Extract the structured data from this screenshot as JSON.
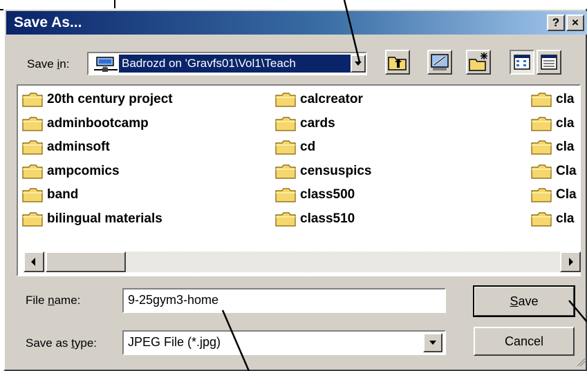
{
  "dialog": {
    "title": "Save As...",
    "help_label": "?",
    "close_label": "×"
  },
  "save_in": {
    "label_before": "Save ",
    "label_accel": "i",
    "label_after": "n:",
    "value": "Badrozd on 'Gravfs01\\Vol1\\Teach"
  },
  "toolbar": {
    "icons": [
      "up-one-level-icon",
      "desktop-icon",
      "new-folder-icon",
      "list-view-icon",
      "details-view-icon"
    ]
  },
  "files": {
    "col1": [
      "20th century project",
      "adminbootcamp",
      "adminsoft",
      "ampcomics",
      "band",
      "bilingual materials"
    ],
    "col2": [
      "calcreator",
      "cards",
      "cd",
      "censuspics",
      "class500",
      "class510"
    ],
    "col3": [
      "cla",
      "cla",
      "cla",
      "Cla",
      "Cla",
      "cla"
    ]
  },
  "file_name": {
    "label_before": "File ",
    "label_accel": "n",
    "label_after": "ame:",
    "value": "9-25gym3-home"
  },
  "save_type": {
    "label_before": "Save as ",
    "label_accel": "t",
    "label_after": "ype:",
    "value": "JPEG File (*.jpg)"
  },
  "buttons": {
    "save_accel": "S",
    "save_rest": "ave",
    "cancel": "Cancel"
  },
  "colors": {
    "title_start": "#0a246a",
    "title_end": "#a6caf0",
    "face": "#d4d0c8",
    "folder": "#f5d76e"
  }
}
